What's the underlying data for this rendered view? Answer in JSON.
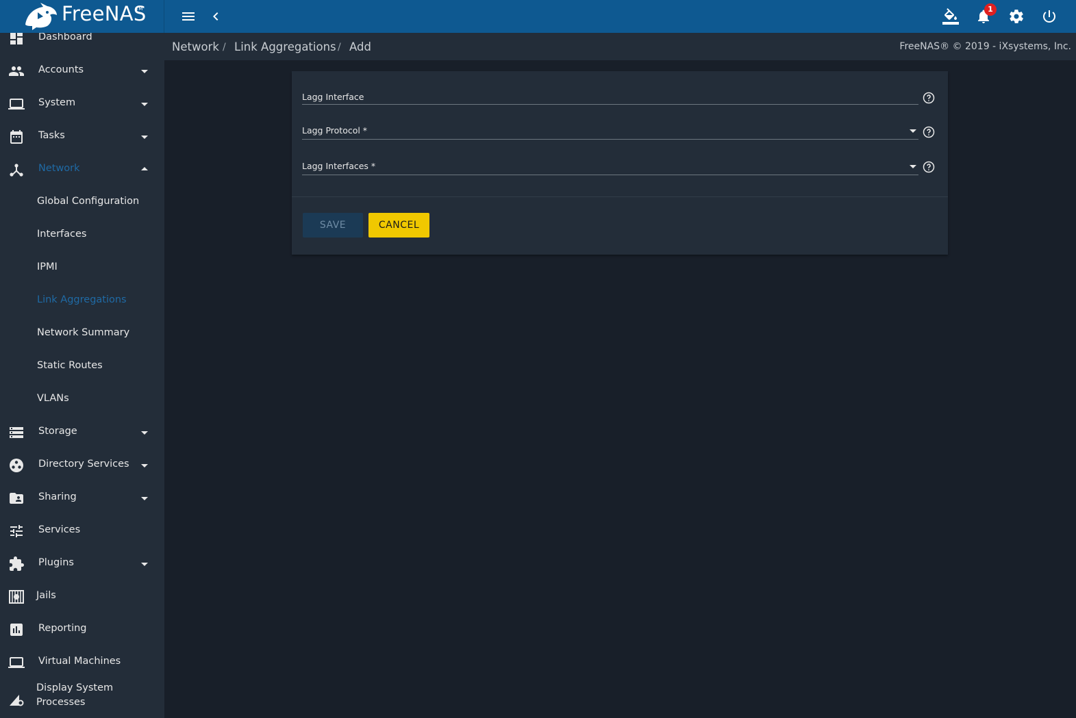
{
  "app": {
    "logo_text": "FreeNAS",
    "logo_tm": "TM"
  },
  "header": {
    "notification_count": "1",
    "icons": [
      "menu-icon",
      "chevron-left-icon",
      "theme-paint-icon",
      "notifications-bell-icon",
      "settings-gear-icon",
      "power-icon"
    ]
  },
  "sidebar": {
    "items": [
      {
        "label": "Dashboard",
        "icon": "dashboard-icon"
      },
      {
        "label": "Accounts",
        "icon": "people-icon"
      },
      {
        "label": "System",
        "icon": "laptop-icon"
      },
      {
        "label": "Tasks",
        "icon": "calendar-icon"
      },
      {
        "label": "Network",
        "icon": "network-icon"
      },
      {
        "label": "Storage",
        "icon": "storage-icon"
      },
      {
        "label": "Directory Services",
        "icon": "directory-icon"
      },
      {
        "label": "Sharing",
        "icon": "shared-folder-icon"
      },
      {
        "label": "Services",
        "icon": "tune-icon"
      },
      {
        "label": "Plugins",
        "icon": "puzzle-icon"
      },
      {
        "label": "Jails",
        "icon": "jail-icon"
      },
      {
        "label": "Reporting",
        "icon": "chart-icon"
      },
      {
        "label": "Virtual Machines",
        "icon": "laptop-icon"
      },
      {
        "label": "Display System\nProcesses",
        "icon": "processes-icon"
      }
    ],
    "network_subitems": [
      {
        "label": "Global Configuration"
      },
      {
        "label": "Interfaces"
      },
      {
        "label": "IPMI"
      },
      {
        "label": "Link Aggregations"
      },
      {
        "label": "Network Summary"
      },
      {
        "label": "Static Routes"
      },
      {
        "label": "VLANs"
      }
    ],
    "active_item": "Network",
    "active_subitem": "Link Aggregations"
  },
  "breadcrumb": {
    "items": [
      "Network",
      "Link Aggregations",
      "Add"
    ],
    "separator": "/"
  },
  "copyright": "FreeNAS® © 2019 - iXsystems, Inc.",
  "form": {
    "fields": [
      {
        "label": "Lagg Interface",
        "value": "",
        "type": "text"
      },
      {
        "label": "Lagg Protocol *",
        "value": "",
        "type": "select"
      },
      {
        "label": "Lagg Interfaces *",
        "value": "",
        "type": "select"
      }
    ],
    "save_label": "SAVE",
    "cancel_label": "CANCEL"
  },
  "colors": {
    "topbar": "#0e5991",
    "sidebar": "#232d39",
    "background": "#181f29",
    "accent": "#1f6aa5",
    "cancel_button": "#f0c800",
    "save_button_disabled": "#1b3a55",
    "badge": "#e02020"
  }
}
